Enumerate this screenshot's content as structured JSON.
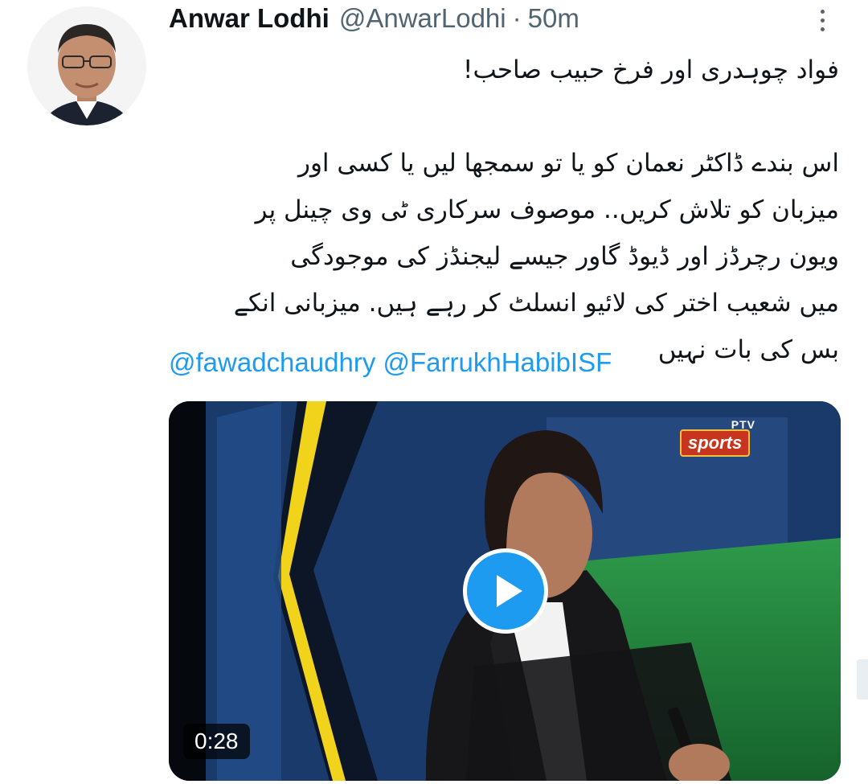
{
  "tweet": {
    "author_name": "Anwar Lodhi",
    "author_handle": "@AnwarLodhi",
    "separator": "·",
    "timestamp": "50m",
    "text_line_1": "فواد چوہدری اور فرخ حبیب صاحب!",
    "text_paragraph_2": [
      "اس بندے ڈاکٹر نعمان کو یا تو سمجھا لیں یا کسی اور",
      "میزبان کو تلاش کریں.. موصوف سرکاری ٹی وی چینل پر",
      "ویون رچرڈز اور ڈیوڈ گاور جیسے لیجنڈز کی موجودگی",
      "میں شعیب اختر کی لائیو انسلٹ کر رہے ہیں. میزبانی انکے",
      "بس کی بات نہیں"
    ],
    "mentions": [
      "@fawadchaudhry",
      "@FarrukhHabibISF"
    ]
  },
  "media": {
    "type": "video",
    "duration": "0:28",
    "logo_top": "PTV",
    "logo_main": "sports"
  },
  "colors": {
    "link": "#1d9bf0",
    "secondary_text": "#536471",
    "primary_text": "#0f1419",
    "play_button": "#1d9bf0"
  },
  "icons": {
    "more": "more-vertical-icon",
    "play": "play-icon"
  }
}
